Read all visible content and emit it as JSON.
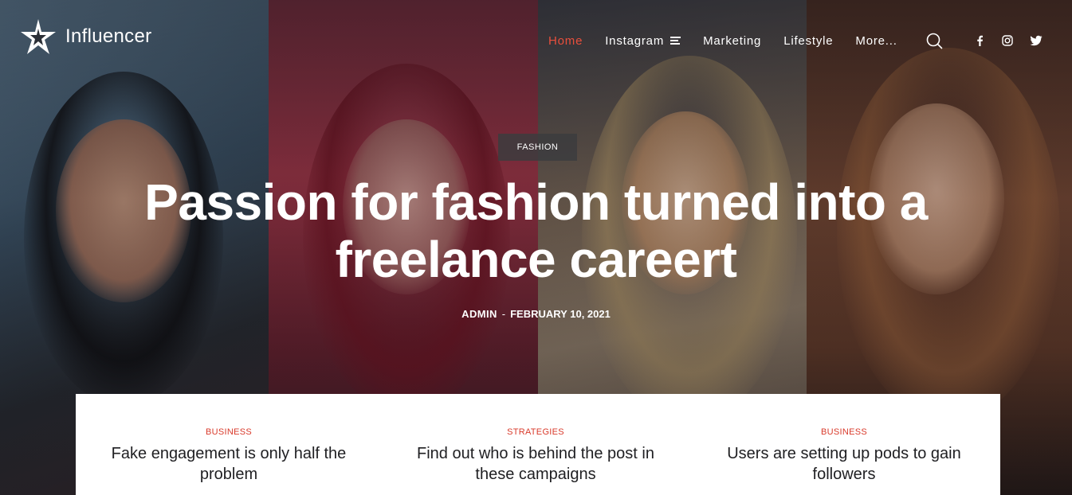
{
  "site": {
    "logo_text": "Influencer"
  },
  "nav": {
    "items": [
      {
        "label": "Home",
        "active": true
      },
      {
        "label": "Instagram",
        "active": false
      },
      {
        "label": "Marketing",
        "active": false
      },
      {
        "label": "Lifestyle",
        "active": false
      },
      {
        "label": "More...",
        "active": false
      }
    ],
    "social": [
      "facebook-icon",
      "instagram-icon",
      "twitter-icon"
    ]
  },
  "hero": {
    "category": "FASHION",
    "title": "Passion for fashion turned into a freelance careert",
    "author": "ADMIN",
    "separator": "-",
    "date": "FEBRUARY 10, 2021"
  },
  "cards": [
    {
      "category": "BUSINESS",
      "title": "Fake engagement is only half the problem"
    },
    {
      "category": "STRATEGIES",
      "title": "Find out who is behind the post in these campaigns"
    },
    {
      "category": "BUSINESS",
      "title": "Users are setting up pods to gain followers"
    }
  ],
  "colors": {
    "accent": "#e94f3c",
    "category_red": "#d93a2b"
  }
}
